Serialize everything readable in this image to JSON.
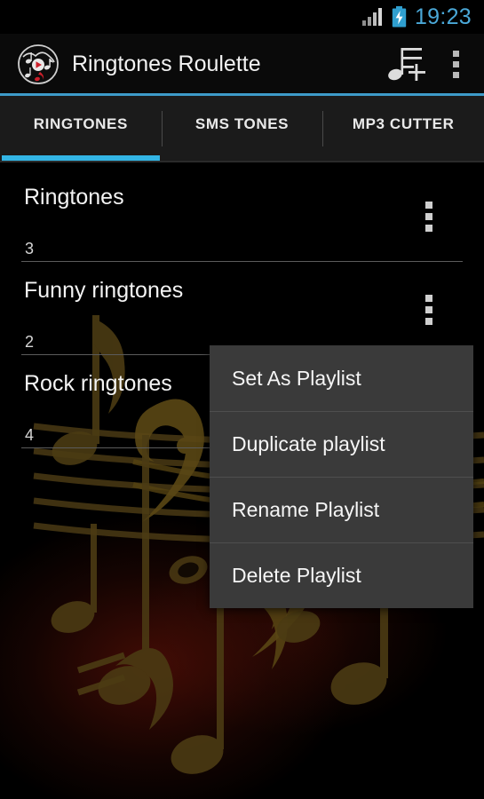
{
  "status_bar": {
    "signal_icon": "signal-bars-icon",
    "battery_icon": "battery-charging-icon",
    "time": "19:23",
    "time_color": "#4aa8d8"
  },
  "action_bar": {
    "logo_icon": "app-logo-music-notes-icon",
    "title": "Ringtones Roulette",
    "add_playlist_icon": "add-music-note-icon",
    "overflow_icon": "overflow-menu-icon"
  },
  "tabs": {
    "active_index": 0,
    "accent_color": "#33b5e5",
    "items": [
      {
        "label": "RINGTONES"
      },
      {
        "label": "SMS TONES"
      },
      {
        "label": "MP3 CUTTER"
      }
    ]
  },
  "playlists": [
    {
      "name": "Ringtones",
      "count": "3",
      "overflow_icon": "row-overflow-icon"
    },
    {
      "name": "Funny ringtones",
      "count": "2",
      "overflow_icon": "row-overflow-icon"
    },
    {
      "name": "Rock ringtones",
      "count": "4",
      "overflow_icon": "row-overflow-icon"
    }
  ],
  "context_menu": {
    "items": [
      {
        "label": "Set As Playlist"
      },
      {
        "label": "Duplicate playlist"
      },
      {
        "label": "Rename Playlist"
      },
      {
        "label": "Delete Playlist"
      }
    ]
  }
}
